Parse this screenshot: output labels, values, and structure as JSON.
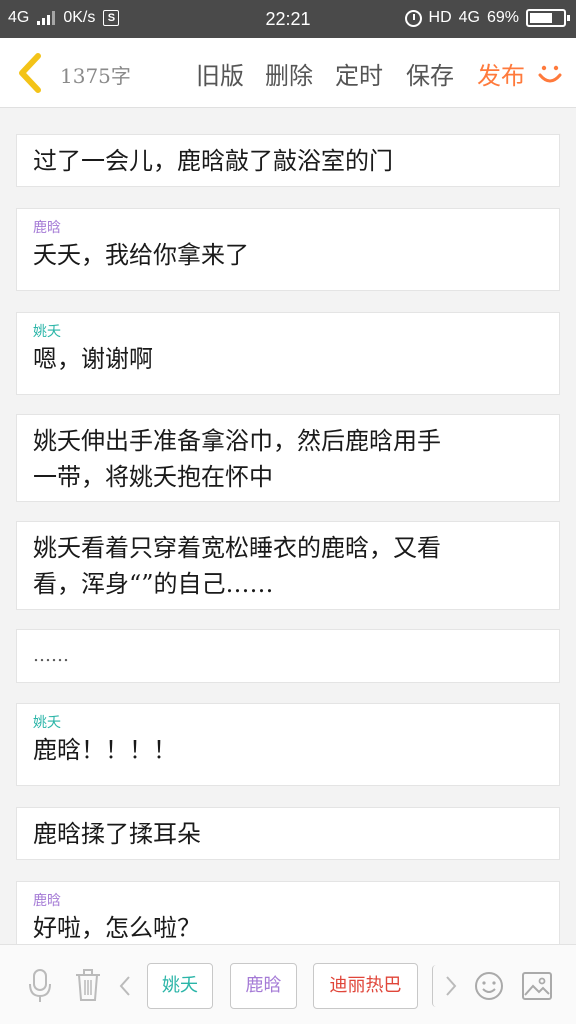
{
  "status_bar": {
    "network": "4G",
    "speed": "0K/s",
    "s_badge": "S",
    "time": "22:21",
    "hd": "HD",
    "net_type": "4G",
    "battery": "69%",
    "battery_level": 0.69
  },
  "toolbar": {
    "back_icon": "chevron-left-icon",
    "word_count": "1375字",
    "old_version": "旧版",
    "delete": "删除",
    "timer": "定时",
    "save": "保存",
    "publish": "发布",
    "smile_icon": "smile-icon",
    "accent_color": "#ff7a3c"
  },
  "colors": {
    "speaker_luhan": "#a57bd6",
    "speaker_yaotian": "#2bb5a8",
    "chip_red": "#e0463a"
  },
  "cards": [
    {
      "speaker": "",
      "lines": [
        "过了一会儿，鹿晗敲了敲浴室的门"
      ]
    },
    {
      "speaker": "鹿晗",
      "lines": [
        "夭夭，我给你拿来了"
      ]
    },
    {
      "speaker": "姚夭",
      "lines": [
        "嗯，谢谢啊"
      ]
    },
    {
      "speaker": "",
      "lines": [
        "姚夭伸出手准备拿浴巾，然后鹿晗用手",
        "一带，将姚夭抱在怀中"
      ]
    },
    {
      "speaker": "",
      "lines": [
        "姚夭看着只穿着宽松睡衣的鹿晗，又看",
        "看，浑身“”的自己……"
      ]
    },
    {
      "speaker": "",
      "lines": [
        "……"
      ]
    },
    {
      "speaker": "姚夭",
      "lines": [
        "鹿晗！！！！"
      ]
    },
    {
      "speaker": "",
      "lines": [
        "鹿晗揉了揉耳朵"
      ]
    },
    {
      "speaker": "鹿晗",
      "lines": [
        "好啦，怎么啦？"
      ]
    }
  ],
  "bottom_bar": {
    "chips": [
      "姚夭",
      "鹿晗",
      "迪丽热巴"
    ],
    "icons": [
      "microphone-icon",
      "trash-icon",
      "chevron-left-icon",
      "chevron-right-icon",
      "emoji-icon",
      "image-icon"
    ]
  }
}
